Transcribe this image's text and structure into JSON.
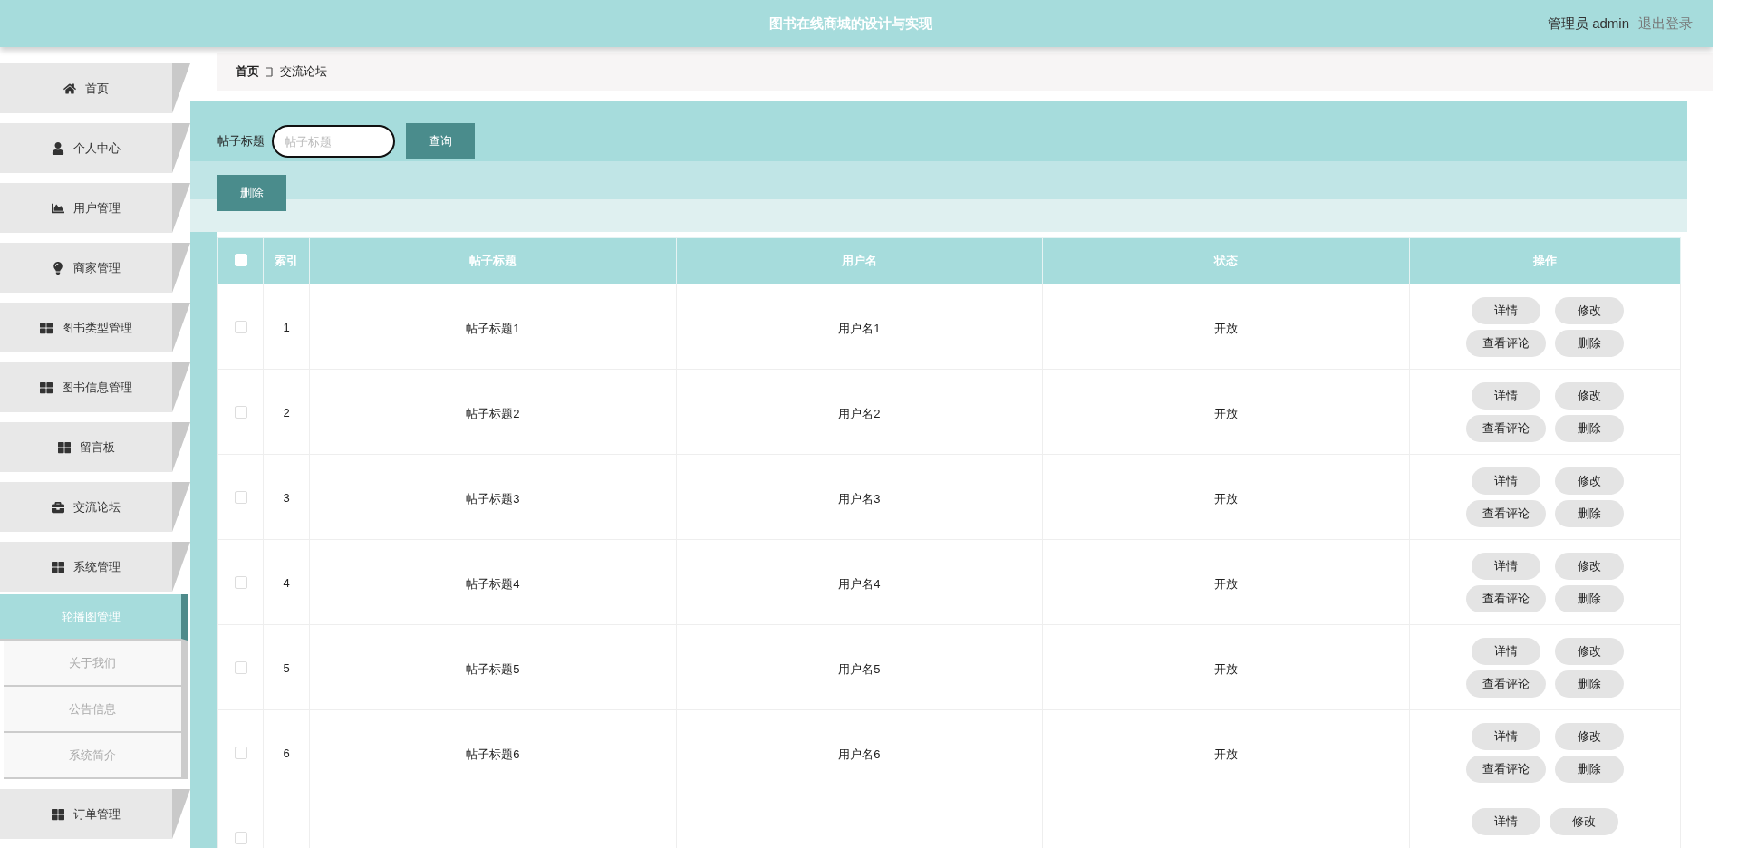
{
  "header": {
    "title": "图书在线商城的设计与实现",
    "user": "管理员 admin",
    "logout": "退出登录"
  },
  "sidebar": {
    "items": [
      {
        "label": "首页"
      },
      {
        "label": "个人中心"
      },
      {
        "label": "用户管理"
      },
      {
        "label": "商家管理"
      },
      {
        "label": "图书类型管理"
      },
      {
        "label": "图书信息管理"
      },
      {
        "label": "留言板"
      },
      {
        "label": "交流论坛"
      },
      {
        "label": "系统管理",
        "children": [
          {
            "label": "轮播图管理",
            "selected": true
          },
          {
            "label": "关于我们",
            "selected": false
          },
          {
            "label": "公告信息",
            "selected": false
          },
          {
            "label": "系统简介",
            "selected": false
          }
        ]
      },
      {
        "label": "订单管理"
      }
    ]
  },
  "breadcrumb": [
    "首页",
    "交流论坛"
  ],
  "search": {
    "label": "帖子标题",
    "placeholder": "帖子标题",
    "button": "查询"
  },
  "delete_button": "删除",
  "table": {
    "header_checked": false,
    "columns": [
      "索引",
      "帖子标题",
      "用户名",
      "状态",
      "操作"
    ],
    "rows": [
      {
        "checked": false,
        "index": "1",
        "title": "帖子标题1",
        "user": "用户名1",
        "status": "开放",
        "actions": [
          "详情",
          "修改",
          "查看评论",
          "删除"
        ]
      },
      {
        "checked": false,
        "index": "2",
        "title": "帖子标题2",
        "user": "用户名2",
        "status": "开放",
        "actions": [
          "详情",
          "修改",
          "查看评论",
          "删除"
        ]
      },
      {
        "checked": false,
        "index": "3",
        "title": "帖子标题3",
        "user": "用户名3",
        "status": "开放",
        "actions": [
          "详情",
          "修改",
          "查看评论",
          "删除"
        ]
      },
      {
        "checked": false,
        "index": "4",
        "title": "帖子标题4",
        "user": "用户名4",
        "status": "开放",
        "actions": [
          "详情",
          "修改",
          "查看评论",
          "删除"
        ]
      },
      {
        "checked": false,
        "index": "5",
        "title": "帖子标题5",
        "user": "用户名5",
        "status": "开放",
        "actions": [
          "详情",
          "修改",
          "查看评论",
          "删除"
        ]
      },
      {
        "checked": false,
        "index": "6",
        "title": "帖子标题6",
        "user": "用户名6",
        "status": "开放",
        "actions": [
          "详情",
          "修改",
          "查看评论",
          "删除"
        ]
      },
      {
        "checked": false,
        "actions": [
          "详情",
          "修改"
        ]
      }
    ]
  }
}
